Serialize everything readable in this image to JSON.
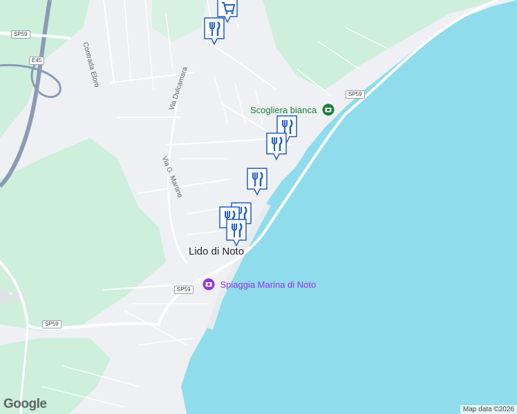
{
  "map": {
    "colors": {
      "land": "#eef0f3",
      "green": "#cdefdc",
      "sea": "#8edcec",
      "road": "#ffffff",
      "motorway": "#8a9bb4",
      "pin": "#1f5cc6",
      "green_poi": "#188038",
      "purple_poi": "#9334e6"
    },
    "place_label": "Lido di Noto",
    "road_labels": [
      "Contrada Eloro",
      "Via Dulcamara",
      "Via G. Martino"
    ],
    "road_shields": [
      "SP59",
      "E45",
      "SP59",
      "SP59",
      "SP59"
    ],
    "poi_labels": [
      {
        "text": "Scogliera bianca",
        "icon": "camera-icon",
        "color": "#188038"
      },
      {
        "text": "Spiaggia Marina di Noto",
        "icon": "beach-icon",
        "color": "#9334e6"
      }
    ],
    "markers": [
      {
        "type": "shopping-cart-icon"
      },
      {
        "type": "restaurant-icon"
      },
      {
        "type": "restaurant-icon"
      },
      {
        "type": "restaurant-icon"
      },
      {
        "type": "restaurant-icon"
      },
      {
        "type": "restaurant-icon"
      },
      {
        "type": "restaurant-icon"
      },
      {
        "type": "restaurant-icon"
      }
    ],
    "attribution": "Map data ©2026",
    "logo": "Google"
  }
}
